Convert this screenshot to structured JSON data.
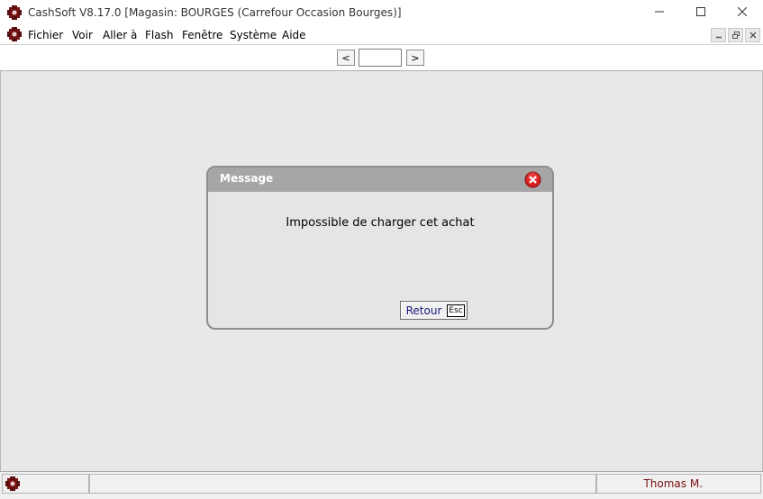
{
  "window": {
    "title": "CashSoft V8.17.0 [Magasin: BOURGES (Carrefour Occasion Bourges)]",
    "app_icon": "cashsoft-logo-icon",
    "controls": [
      "minimize-icon",
      "maximize-icon",
      "close-icon"
    ]
  },
  "menu": {
    "items": [
      {
        "label": "Fichier"
      },
      {
        "label": "Voir"
      },
      {
        "label": "Aller à"
      },
      {
        "label": "Flash"
      },
      {
        "label": "Fenêtre"
      },
      {
        "label": "Système"
      },
      {
        "label": "Aide"
      }
    ],
    "mdi_controls": [
      "mdi-minimize-icon",
      "mdi-restore-icon",
      "mdi-close-icon"
    ]
  },
  "navigation": {
    "prev_label": "<",
    "next_label": ">",
    "page_value": ""
  },
  "dialog": {
    "title": "Message",
    "message": "Impossible de charger cet achat",
    "button_label": "Retour",
    "button_shortcut": "Esc"
  },
  "status": {
    "user": "Thomas M."
  },
  "colors": {
    "dialog_header": "#a6a6a6",
    "dialog_body": "#e5e5e5",
    "workspace": "#e8e8e8",
    "close_red": "#d62020",
    "user_text": "#7a1010"
  }
}
